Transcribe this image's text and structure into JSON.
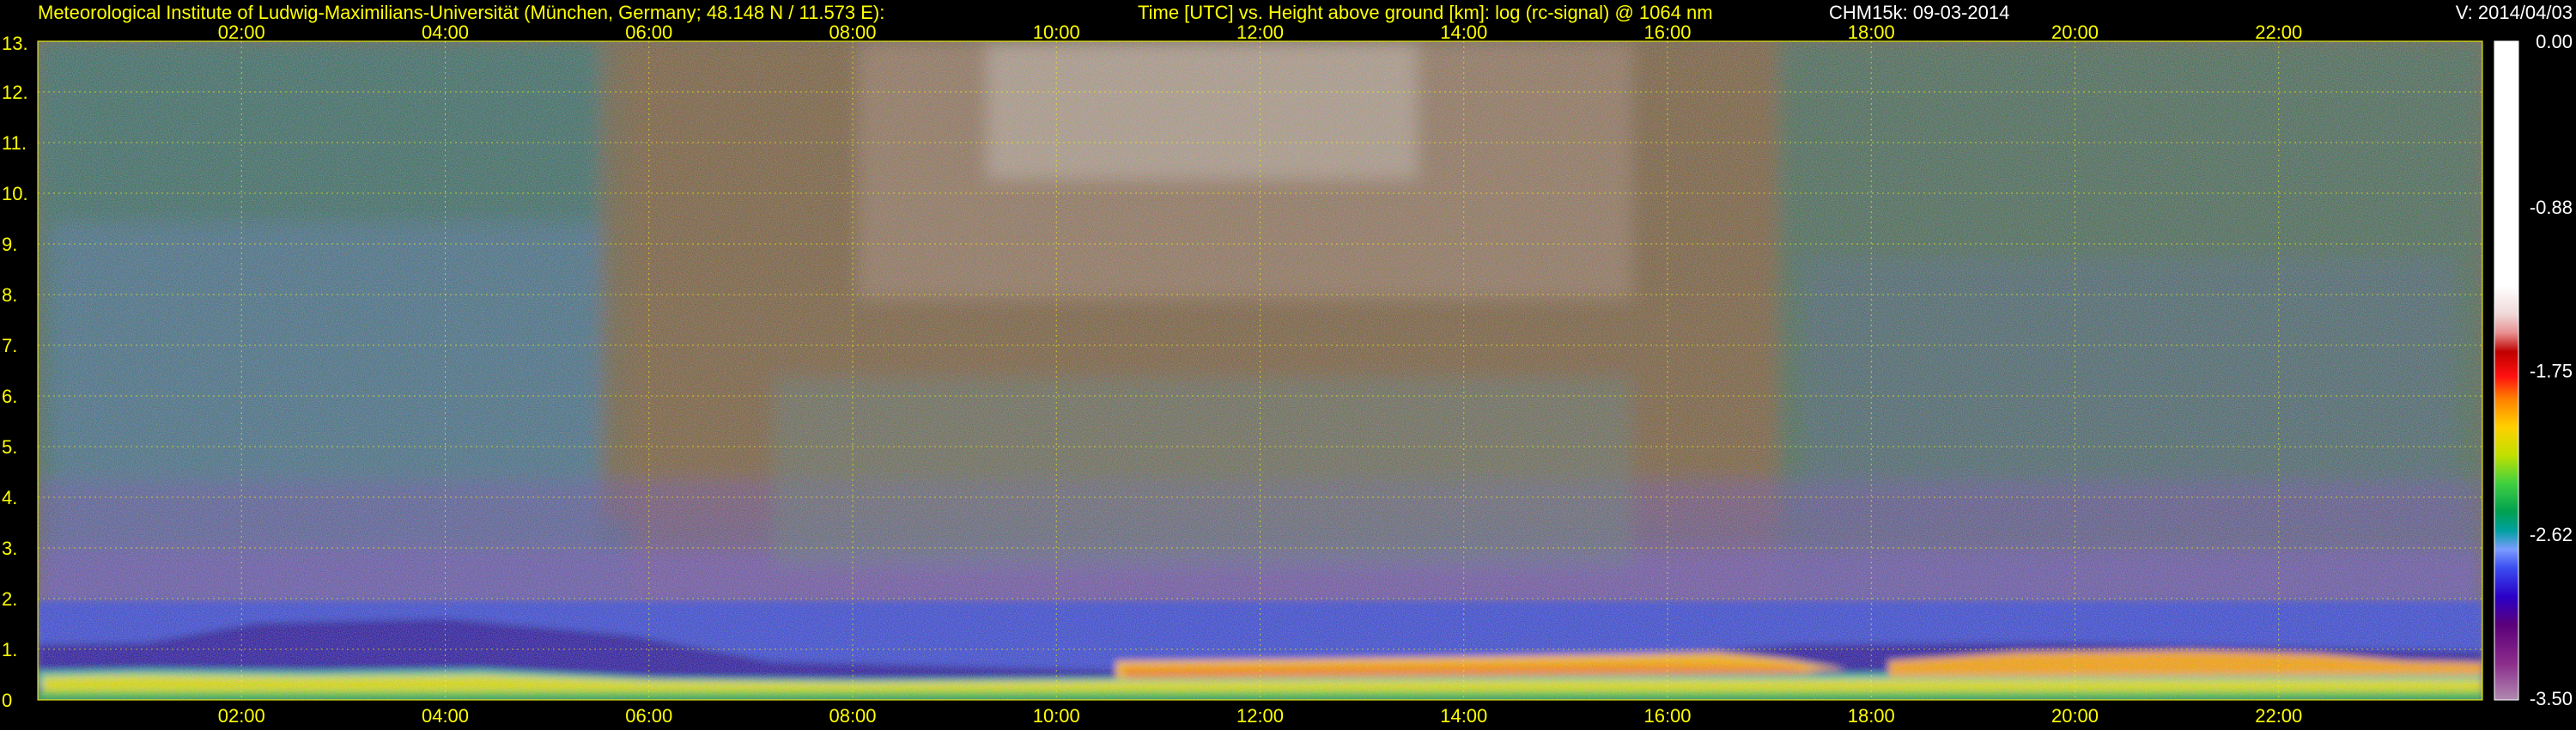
{
  "header": {
    "institute": "Meteorological Institute of Ludwig-Maximilians-Universität (München, Germany; 48.148 N / 11.573 E):",
    "plot_description": "Time [UTC] vs. Height above ground [km]: log (rc-signal) @ 1064 nm",
    "instrument_date": "CHM15k: 09-03-2014",
    "version": "V: 2014/04/03"
  },
  "colors": {
    "background": "#000000",
    "text": "#ffff00",
    "header_white": "#ffffff",
    "grid": "#ffff00"
  },
  "chart_data": {
    "type": "heatmap",
    "title": "Time [UTC] vs. Height above ground [km]: log (rc-signal) @ 1064 nm",
    "xlabel": "Time [UTC]",
    "ylabel": "Height above ground [km]",
    "xlim": [
      0,
      24
    ],
    "ylim": [
      0,
      13
    ],
    "x_ticks": [
      2,
      4,
      6,
      8,
      10,
      12,
      14,
      16,
      18,
      20,
      22
    ],
    "x_tick_labels": [
      "02:00",
      "04:00",
      "06:00",
      "08:00",
      "10:00",
      "12:00",
      "14:00",
      "16:00",
      "18:00",
      "20:00",
      "22:00"
    ],
    "y_ticks": [
      0,
      1,
      2,
      3,
      4,
      5,
      6,
      7,
      8,
      9,
      10,
      11,
      12,
      13
    ],
    "y_tick_labels": [
      "0",
      "1.",
      "2.",
      "3.",
      "4.",
      "5.",
      "6.",
      "7.",
      "8.",
      "9.",
      "10.",
      "11.",
      "12.",
      "13."
    ],
    "grid": true,
    "colorbar": {
      "min": -3.5,
      "max": 0.0,
      "ticks": [
        0.0,
        -0.88,
        -1.75,
        -2.62,
        -3.5
      ],
      "tick_labels": [
        "0.00",
        "-0.88",
        "-1.75",
        "-2.62",
        "-3.50"
      ],
      "position": "right",
      "stops": [
        {
          "value": -3.5,
          "color": "#b08ab0"
        },
        {
          "value": -3.3,
          "color": "#8a2a8a"
        },
        {
          "value": -3.1,
          "color": "#5a007a"
        },
        {
          "value": -2.95,
          "color": "#2a00c8"
        },
        {
          "value": -2.8,
          "color": "#3a4cf0"
        },
        {
          "value": -2.7,
          "color": "#7a9cff"
        },
        {
          "value": -2.6,
          "color": "#00a0a0"
        },
        {
          "value": -2.5,
          "color": "#00a050"
        },
        {
          "value": -2.35,
          "color": "#40d040"
        },
        {
          "value": -2.2,
          "color": "#c0e000"
        },
        {
          "value": -2.05,
          "color": "#ffd000"
        },
        {
          "value": -1.9,
          "color": "#ff8000"
        },
        {
          "value": -1.78,
          "color": "#ff1010"
        },
        {
          "value": -1.65,
          "color": "#c00000"
        },
        {
          "value": -1.55,
          "color": "#e89090"
        },
        {
          "value": -1.45,
          "color": "#f0d8d8"
        },
        {
          "value": -1.3,
          "color": "#ffffff"
        },
        {
          "value": 0.0,
          "color": "#ffffff"
        }
      ]
    }
  }
}
